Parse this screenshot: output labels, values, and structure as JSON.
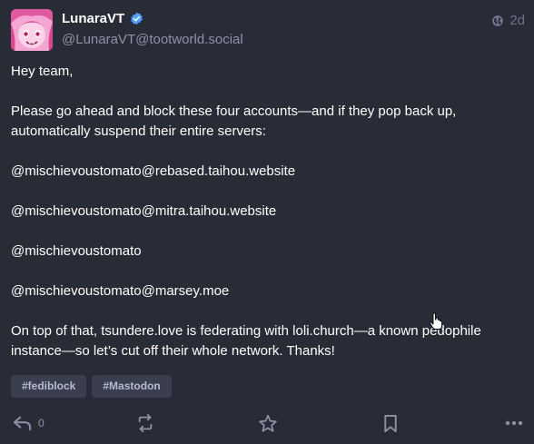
{
  "post": {
    "author": {
      "display_name": "LunaraVT",
      "handle": "@LunaraVT@tootworld.social",
      "verified": true
    },
    "visibility_icon": "globe-icon",
    "time_ago": "2d",
    "content": {
      "greeting": "Hey team,",
      "request": "Please go ahead and block these four accounts—and if they pop back up, automatically suspend their entire servers:",
      "accounts": [
        "@mischievoustomato@rebased.taihou.website",
        "@mischievoustomato@mitra.taihou.website",
        "@mischievoustomato",
        "@mischievoustomato@marsey.moe"
      ],
      "closing": "On top of that, tsundere.love is federating with loli.church—a known pedophile instance—so let’s cut off their whole network. Thanks!"
    },
    "hashtags": [
      "#fediblock",
      "#Mastodon"
    ],
    "actions": {
      "reply_count": "0",
      "reply_icon": "reply-icon",
      "boost_icon": "boost-icon",
      "favourite_icon": "star-icon",
      "bookmark_icon": "bookmark-icon",
      "more_icon": "more-icon"
    }
  },
  "colors": {
    "background": "#282c37",
    "text": "#ffffff",
    "muted": "#8e92a6",
    "verified": "#4ea2ff",
    "hashtag_bg": "#393f4f",
    "avatar_pink": "#f58fc8"
  }
}
